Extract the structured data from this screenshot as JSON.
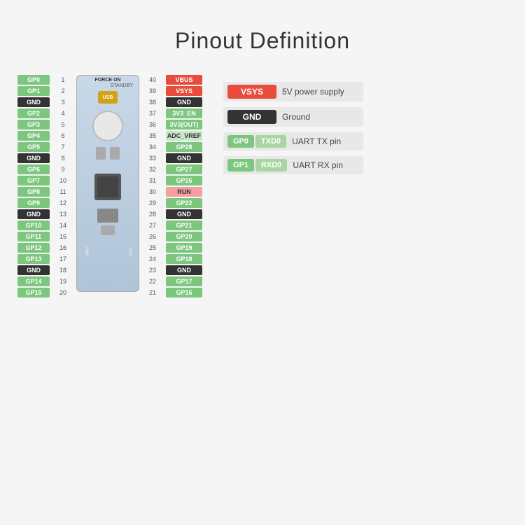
{
  "title": "Pinout Definition",
  "left_pins": [
    {
      "label": "GP0",
      "color": "green"
    },
    {
      "label": "GP1",
      "color": "green"
    },
    {
      "label": "GND",
      "color": "black"
    },
    {
      "label": "GP2",
      "color": "green"
    },
    {
      "label": "GP3",
      "color": "green"
    },
    {
      "label": "GP4",
      "color": "green"
    },
    {
      "label": "GP5",
      "color": "green"
    },
    {
      "label": "GND",
      "color": "black"
    },
    {
      "label": "GP6",
      "color": "green"
    },
    {
      "label": "GP7",
      "color": "green"
    },
    {
      "label": "GP8",
      "color": "green"
    },
    {
      "label": "GP9",
      "color": "green"
    },
    {
      "label": "GND",
      "color": "black"
    },
    {
      "label": "GP10",
      "color": "green"
    },
    {
      "label": "GP11",
      "color": "green"
    },
    {
      "label": "GP12",
      "color": "green"
    },
    {
      "label": "GP13",
      "color": "green"
    },
    {
      "label": "GND",
      "color": "black"
    },
    {
      "label": "GP14",
      "color": "green"
    },
    {
      "label": "GP15",
      "color": "green"
    }
  ],
  "left_numbers": [
    1,
    2,
    3,
    4,
    5,
    6,
    7,
    8,
    9,
    10,
    11,
    12,
    13,
    14,
    15,
    16,
    17,
    18,
    19,
    20
  ],
  "right_numbers": [
    40,
    39,
    38,
    37,
    36,
    35,
    34,
    33,
    32,
    31,
    30,
    29,
    28,
    27,
    26,
    25,
    24,
    23,
    22,
    21
  ],
  "right_pins": [
    {
      "label": "VBUS",
      "color": "red"
    },
    {
      "label": "VSYS",
      "color": "red"
    },
    {
      "label": "GND",
      "color": "black"
    },
    {
      "label": "3V3_EN",
      "color": "green"
    },
    {
      "label": "3V3(OUT)",
      "color": "green"
    },
    {
      "label": "ADC_VREF",
      "color": "light-green"
    },
    {
      "label": "GP28",
      "color": "green"
    },
    {
      "label": "GND",
      "color": "black"
    },
    {
      "label": "GP27",
      "color": "green"
    },
    {
      "label": "GP26",
      "color": "green"
    },
    {
      "label": "RUN",
      "color": "pink"
    },
    {
      "label": "GP22",
      "color": "green"
    },
    {
      "label": "GND",
      "color": "black"
    },
    {
      "label": "GP21",
      "color": "green"
    },
    {
      "label": "GP20",
      "color": "green"
    },
    {
      "label": "GP19",
      "color": "green"
    },
    {
      "label": "GP18",
      "color": "green"
    },
    {
      "label": "GND",
      "color": "black"
    },
    {
      "label": "GP17",
      "color": "green"
    },
    {
      "label": "GP16",
      "color": "green"
    }
  ],
  "legend": [
    {
      "badge_label": "VSYS",
      "badge_color": "red",
      "description": "5V power supply"
    },
    {
      "badge_label": "GND",
      "badge_color": "black",
      "description": "Ground"
    },
    {
      "badge1_label": "GP0",
      "badge1_color": "green",
      "badge2_label": "TXD0",
      "badge2_color": "green2",
      "description": "UART TX pin"
    },
    {
      "badge1_label": "GP1",
      "badge1_color": "green",
      "badge2_label": "RXD0",
      "badge2_color": "green2",
      "description": "UART RX pin"
    }
  ],
  "board": {
    "label_top": "FORCE ON",
    "label_standby": "STANDBY",
    "usb_label": "USB"
  }
}
